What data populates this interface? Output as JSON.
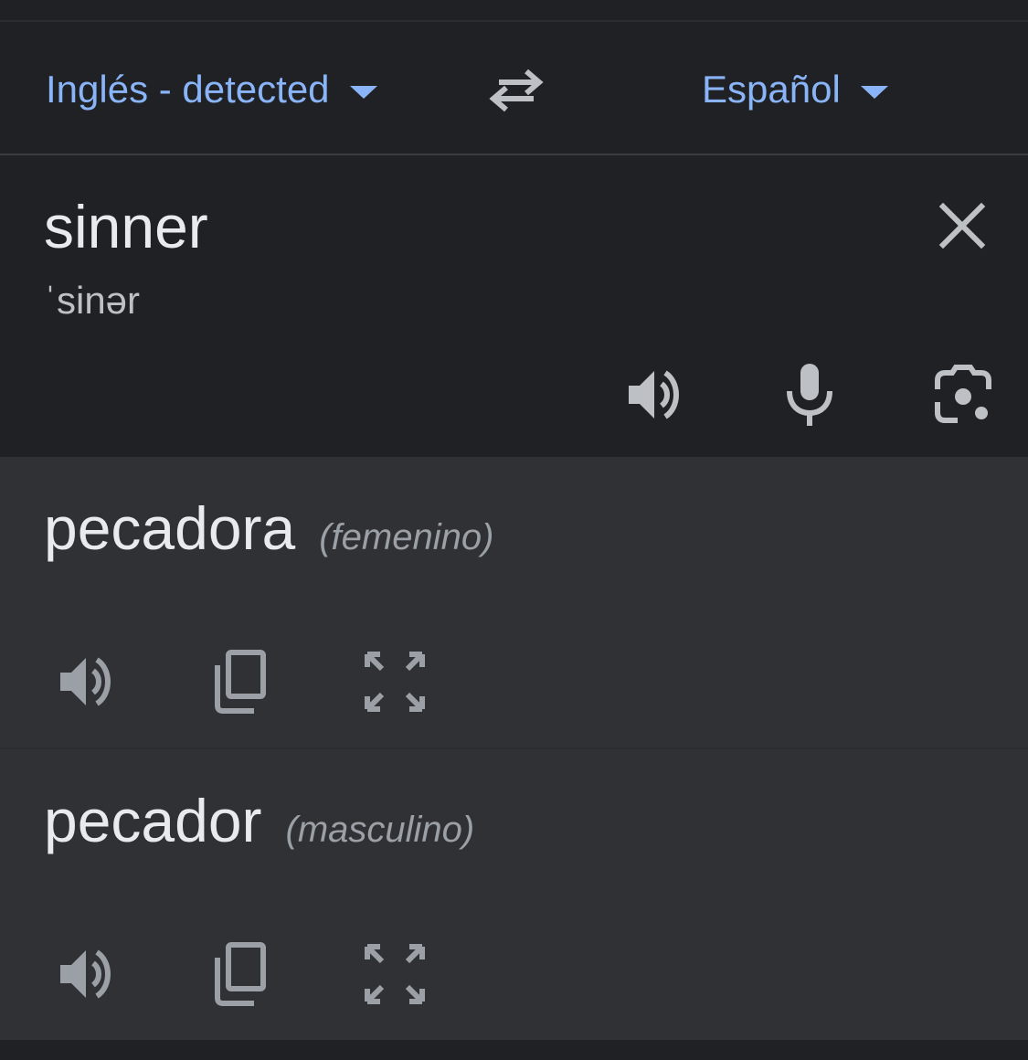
{
  "lang_bar": {
    "source_language": "Inglés - detected",
    "target_language": "Español",
    "swap_icon": "swap-arrows-icon",
    "caret_icon": "caret-down-icon"
  },
  "source": {
    "text": "sinner",
    "phonetic": "ˈsinər",
    "clear_icon": "close-icon",
    "actions": [
      "speaker-icon",
      "microphone-icon",
      "camera-lens-icon"
    ]
  },
  "results": [
    {
      "word": "pecadora",
      "gender": "(femenino)",
      "actions": [
        "speaker-icon",
        "copy-icon",
        "fullscreen-icon"
      ]
    },
    {
      "word": "pecador",
      "gender": "(masculino)",
      "actions": [
        "speaker-icon",
        "copy-icon",
        "fullscreen-icon"
      ]
    }
  ],
  "colors": {
    "background": "#202124",
    "result_background": "#303134",
    "accent": "#8ab4f8",
    "text_primary": "#e8eaed",
    "text_secondary": "#9aa0a6",
    "icon": "#bdc1c6"
  }
}
